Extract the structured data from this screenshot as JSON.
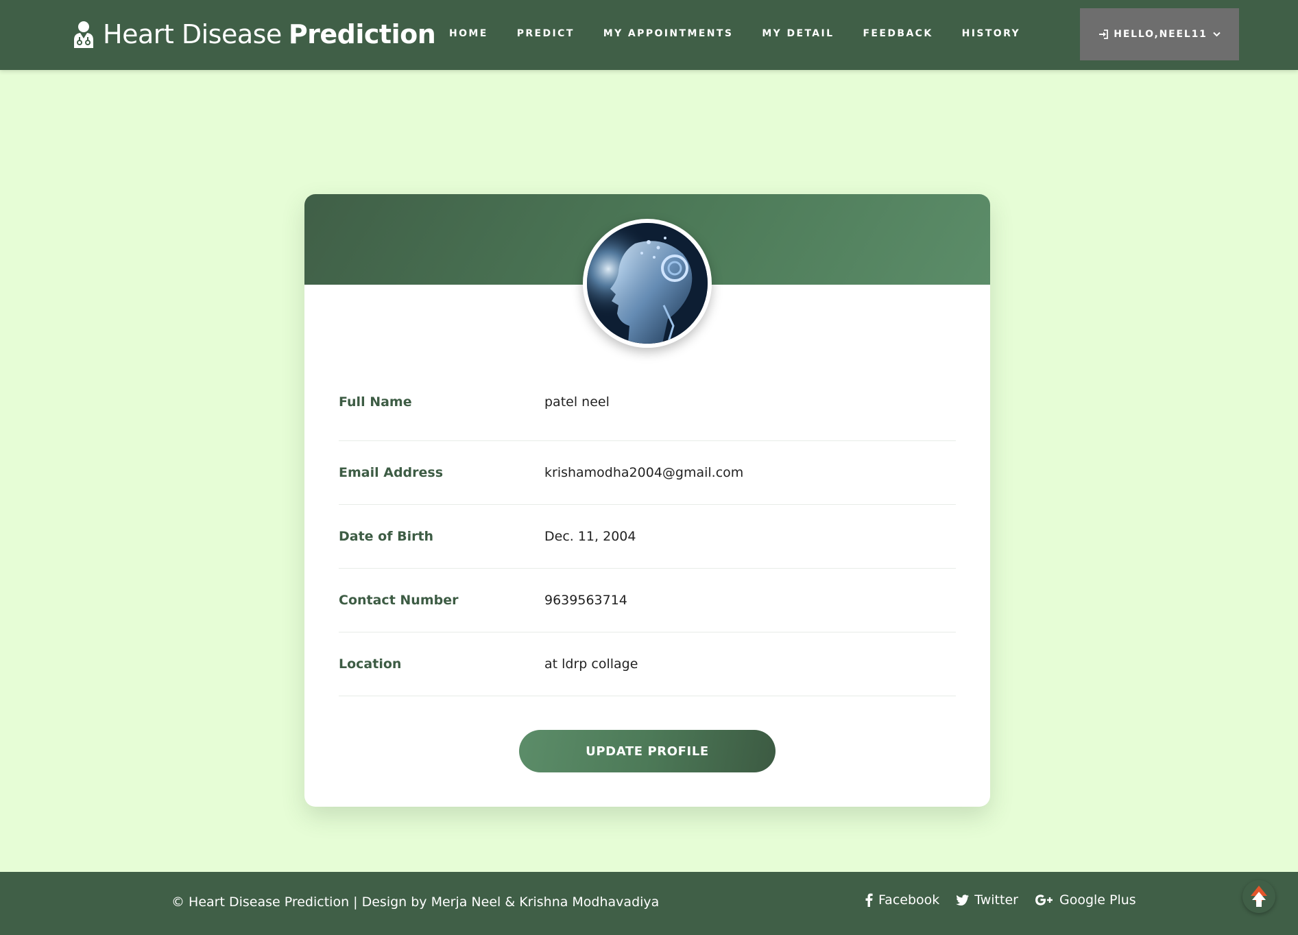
{
  "header": {
    "brand_light": "Heart Disease",
    "brand_bold": "Prediction",
    "nav": [
      "HOME",
      "PREDICT",
      "MY APPOINTMENTS",
      "MY DETAIL",
      "FEEDBACK",
      "HISTORY"
    ],
    "user_label": "HELLO,NEEL11"
  },
  "profile": {
    "rows": [
      {
        "label": "Full Name",
        "value": "patel neel"
      },
      {
        "label": "Email Address",
        "value": "krishamodha2004@gmail.com"
      },
      {
        "label": "Date of Birth",
        "value": "Dec. 11, 2004"
      },
      {
        "label": "Contact Number",
        "value": "9639563714"
      },
      {
        "label": "Location",
        "value": "at ldrp collage"
      }
    ],
    "update_label": "UPDATE PROFILE"
  },
  "footer": {
    "copyright": "© Heart Disease Prediction | Design by Merja Neel & Krishna Modhavadiya",
    "social": [
      {
        "label": "Facebook",
        "icon": "facebook-icon"
      },
      {
        "label": "Twitter",
        "icon": "twitter-icon"
      },
      {
        "label": "Google Plus",
        "icon": "google-plus-icon"
      }
    ]
  },
  "colors": {
    "page_bg": "#e6fdd6",
    "primary": "#405f47",
    "accent_light": "#5c8d69",
    "user_button": "#6e6e6e"
  }
}
